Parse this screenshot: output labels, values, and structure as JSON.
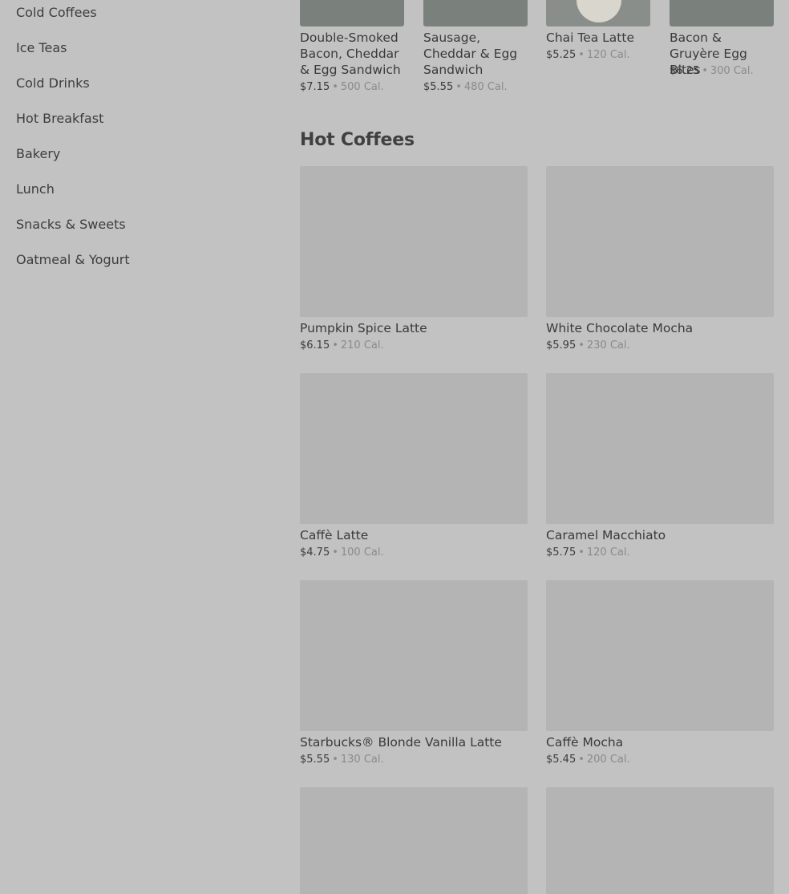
{
  "sidebar": {
    "items": [
      {
        "label": "Cold Coffees"
      },
      {
        "label": "Ice Teas"
      },
      {
        "label": "Cold Drinks"
      },
      {
        "label": "Hot Breakfast"
      },
      {
        "label": "Bakery"
      },
      {
        "label": "Lunch"
      },
      {
        "label": "Snacks & Sweets"
      },
      {
        "label": "Oatmeal & Yogurt"
      }
    ]
  },
  "top_row": {
    "items": [
      {
        "name": "Double-Smoked Bacon, Cheddar & Egg Sandwich",
        "price": "$7.15",
        "separator": "•",
        "calories": "500 Cal."
      },
      {
        "name": "Sausage, Cheddar & Egg Sandwich",
        "price": "$5.55",
        "separator": "•",
        "calories": "480 Cal."
      },
      {
        "name": "Chai Tea Latte",
        "price": "$5.25",
        "separator": "•",
        "calories": "120 Cal."
      },
      {
        "name": "Bacon & Gruyère Egg Bites",
        "price": "$6.25",
        "separator": "•",
        "calories": "300 Cal."
      }
    ]
  },
  "hot_coffees": {
    "title": "Hot Coffees",
    "items": [
      {
        "name": "Pumpkin Spice Latte",
        "price": "$6.15",
        "separator": "•",
        "calories": "210 Cal."
      },
      {
        "name": "White Chocolate Mocha",
        "price": "$5.95",
        "separator": "•",
        "calories": "230 Cal."
      },
      {
        "name": "Caffè Latte",
        "price": "$4.75",
        "separator": "•",
        "calories": "100 Cal."
      },
      {
        "name": "Caramel Macchiato",
        "price": "$5.75",
        "separator": "•",
        "calories": "120 Cal."
      },
      {
        "name": "Starbucks® Blonde Vanilla Latte",
        "price": "$5.55",
        "separator": "•",
        "calories": "130 Cal."
      },
      {
        "name": "Caffè Mocha",
        "price": "$5.45",
        "separator": "•",
        "calories": "200 Cal."
      }
    ]
  },
  "colors": {
    "overlay_background": "#c2c2c2",
    "image_placeholder": "#b4b4b4",
    "text": "#3a3a3a",
    "muted_text": "#8a8a8a"
  }
}
